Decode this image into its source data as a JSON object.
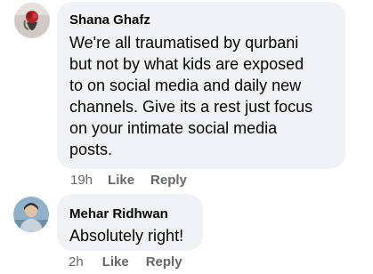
{
  "comments": [
    {
      "author": "Shana Ghafz",
      "lines": [
        "We're all traumatised by qurbani",
        "but not by what kids are exposed",
        "to on social media and daily new",
        "channels. Give its a rest just focus",
        "on your intimate social media",
        "posts."
      ],
      "time": "19h",
      "like_label": "Like",
      "reply_label": "Reply"
    },
    {
      "author": "Mehar Ridhwan",
      "lines": [
        "Absolutely right!"
      ],
      "time": "2h",
      "like_label": "Like",
      "reply_label": "Reply"
    }
  ],
  "colors": {
    "bubble_bg": "#f0f2f5",
    "meta_text": "#65676b",
    "text": "#050505"
  }
}
